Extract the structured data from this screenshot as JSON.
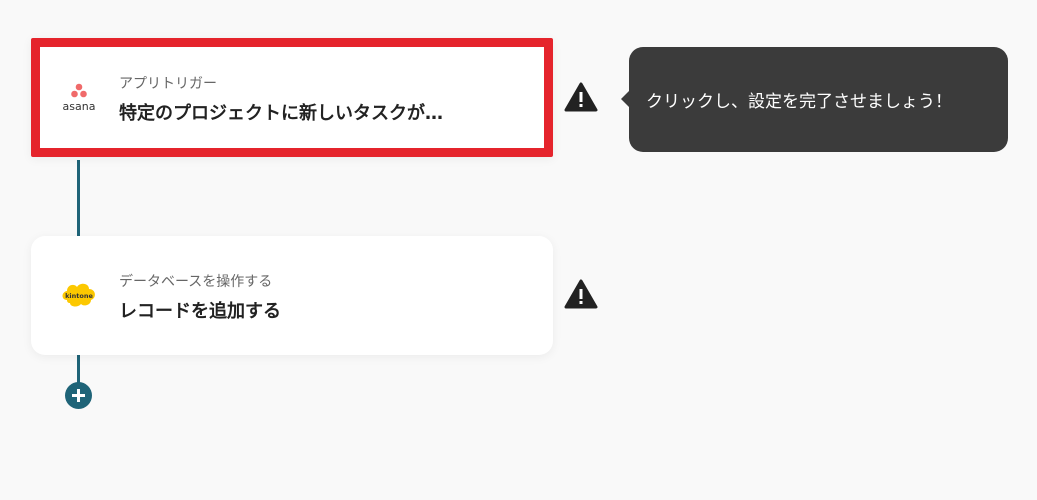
{
  "steps": [
    {
      "app": "asana",
      "subtitle": "アプリトリガー",
      "title": "特定のプロジェクトに新しいタスクが…",
      "logo_text": "asana",
      "status_icon": "warning-icon"
    },
    {
      "app": "kintone",
      "subtitle": "データベースを操作する",
      "title": "レコードを追加する",
      "logo_text": "kintone",
      "status_icon": "warning-icon"
    }
  ],
  "tooltip": {
    "text": "クリックし、設定を完了させましょう！"
  },
  "add_step": {
    "icon": "plus-icon"
  },
  "colors": {
    "highlight": "#e5242c",
    "connector": "#1f6478",
    "tooltip_bg": "#3b3b3b",
    "asana_brand": "#f06a6a",
    "kintone_brand": "#fcc800"
  }
}
